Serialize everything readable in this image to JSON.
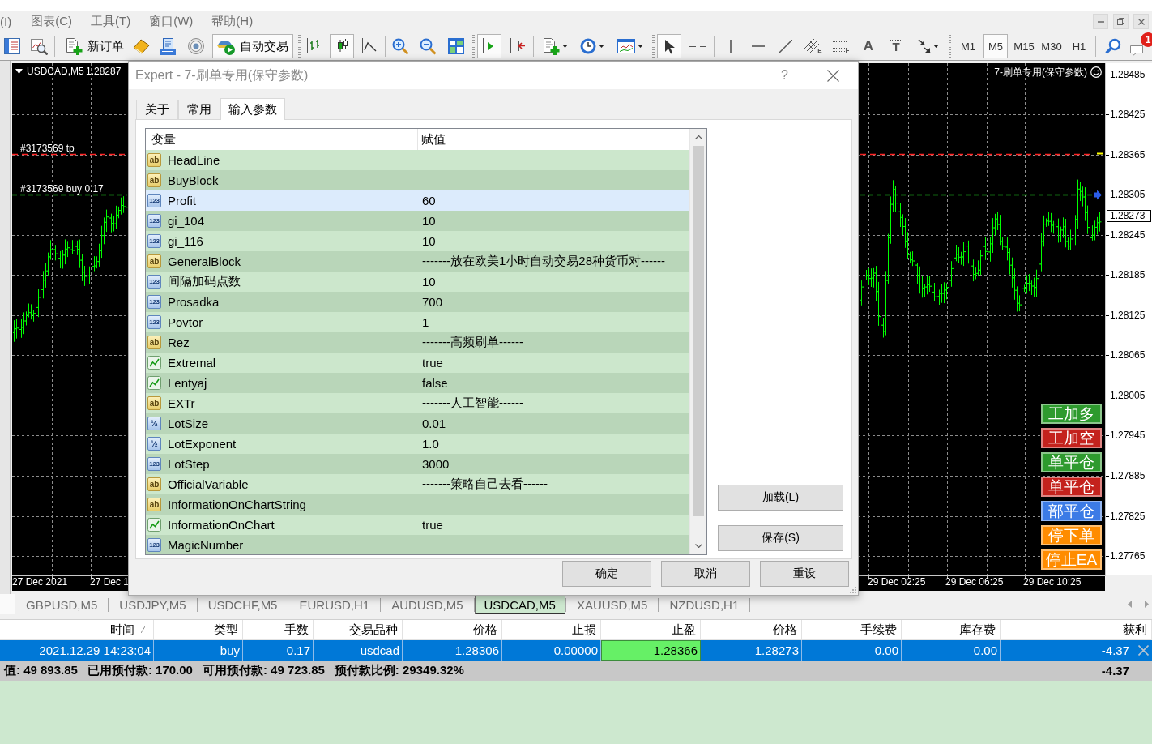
{
  "menu": [
    "(I)",
    "图表(C)",
    "工具(T)",
    "窗口(W)",
    "帮助(H)"
  ],
  "toolbar": {
    "new_order": "新订单",
    "auto_trading": {
      "label": "自动交易",
      "on": true
    },
    "chart_types": [
      {
        "selected": false
      },
      {
        "selected": true
      },
      {
        "selected": false
      }
    ],
    "chart_shift": {
      "on": true
    },
    "auto_scroll": {
      "on": false
    },
    "cursor_tools": [
      {
        "selected": true
      },
      {
        "selected": false
      }
    ],
    "channel_mark": "E",
    "fibo_mark": "F",
    "text_tool": "A",
    "label_tool": "T",
    "timeframes": [
      {
        "label": "M1",
        "selected": false
      },
      {
        "label": "M5",
        "selected": true
      },
      {
        "label": "M15",
        "selected": false
      },
      {
        "label": "M30",
        "selected": false
      },
      {
        "label": "H1",
        "selected": false
      }
    ],
    "notifications": "1"
  },
  "chart": {
    "symbol": "USDCAD,M5",
    "last_price": "1.28287",
    "expert_name": "7-刷单专用(保守参数)",
    "order_labels": [
      {
        "kind": "take_profit",
        "text": "#3173569 tp"
      },
      {
        "kind": "open",
        "text": "#3173569 buy 0.17"
      }
    ],
    "price_scale": [
      "1.28485",
      "1.28425",
      "1.28365",
      "1.28305",
      "1.28245",
      "1.28185",
      "1.28125",
      "1.28065",
      "1.28005",
      "1.27945",
      "1.27885",
      "1.27825",
      "1.27765"
    ],
    "bid": "1.28273",
    "time_scale": [
      "27 Dec 2021",
      "27 Dec 1",
      "29 Dec 02:25",
      "29 Dec 06:25",
      "29 Dec 10:25"
    ],
    "panel_buttons": [
      {
        "label": "工加多",
        "color": "#2e9a2e"
      },
      {
        "label": "工加空",
        "color": "#c4221d"
      },
      {
        "label": "单平仓",
        "color": "#2e9a2e"
      },
      {
        "label": "单平仓",
        "color": "#c4221d"
      },
      {
        "label": "部平仓",
        "color": "#3c7be6"
      },
      {
        "label": "停下单",
        "color": "#ff8c00"
      },
      {
        "label": "停止EA",
        "color": "#ff8c00"
      }
    ]
  },
  "dialog": {
    "title": "Expert - 7-刷单专用(保守参数)",
    "help": "?",
    "tabs": [
      {
        "label": "关于",
        "selected": false
      },
      {
        "label": "常用",
        "selected": false
      },
      {
        "label": "输入参数",
        "selected": true
      }
    ],
    "table": {
      "columns": [
        "变量",
        "赋值"
      ],
      "rows": [
        {
          "kind": "string",
          "badge": "ab",
          "name": "HeadLine",
          "selected": false
        },
        {
          "kind": "string",
          "badge": "ab",
          "name": "BuyBlock",
          "selected": false
        },
        {
          "kind": "int",
          "badge": "123",
          "name": "Profit",
          "value": "60",
          "selected": true
        },
        {
          "kind": "int",
          "badge": "123",
          "name": "gi_104",
          "value": "10",
          "selected": false
        },
        {
          "kind": "int",
          "badge": "123",
          "name": "gi_116",
          "value": "10",
          "selected": false
        },
        {
          "kind": "string",
          "badge": "ab",
          "name": "GeneralBlock",
          "value": "-------放在欧美1小时自动交易28种货币对------",
          "selected": false
        },
        {
          "kind": "int",
          "badge": "123",
          "name": "间隔加码点数",
          "value": "10",
          "selected": false
        },
        {
          "kind": "int",
          "badge": "123",
          "name": "Prosadka",
          "value": "700",
          "selected": false
        },
        {
          "kind": "int",
          "badge": "123",
          "name": "Povtor",
          "value": "1",
          "selected": false
        },
        {
          "kind": "string",
          "badge": "ab",
          "name": "Rez",
          "value": "-------高频刷单------",
          "selected": false
        },
        {
          "kind": "bool",
          "name": "Extremal",
          "value": "true",
          "selected": false
        },
        {
          "kind": "bool",
          "name": "Lentyaj",
          "value": "false",
          "selected": false
        },
        {
          "kind": "string",
          "badge": "ab",
          "name": "EXTr",
          "value": "-------人工智能------",
          "selected": false
        },
        {
          "kind": "double",
          "badge": "½",
          "name": "LotSize",
          "value": "0.01",
          "selected": false
        },
        {
          "kind": "double",
          "badge": "½",
          "name": "LotExponent",
          "value": "1.0",
          "selected": false
        },
        {
          "kind": "int",
          "badge": "123",
          "name": "LotStep",
          "value": "3000",
          "selected": false
        },
        {
          "kind": "string",
          "badge": "ab",
          "name": "OfficialVariable",
          "value": "-------策略自己去看------",
          "selected": false
        },
        {
          "kind": "string",
          "badge": "ab",
          "name": "InformationOnChartString",
          "selected": false
        },
        {
          "kind": "bool",
          "name": "InformationOnChart",
          "value": "true",
          "selected": false
        },
        {
          "kind": "int",
          "badge": "123",
          "name": "MagicNumber",
          "selected": false
        }
      ]
    },
    "side_buttons": [
      "加载(L)",
      "保存(S)"
    ],
    "buttons": [
      "确定",
      "取消",
      "重设"
    ]
  },
  "chart_tabs": [
    {
      "label": "GBPUSD,M5",
      "selected": false
    },
    {
      "label": "USDJPY,M5",
      "selected": false
    },
    {
      "label": "USDCHF,M5",
      "selected": false
    },
    {
      "label": "EURUSD,H1",
      "selected": false
    },
    {
      "label": "AUDUSD,M5",
      "selected": false
    },
    {
      "label": "USDCAD,M5",
      "selected": true
    },
    {
      "label": "XAUUSD,M5",
      "selected": false
    },
    {
      "label": "NZDUSD,H1",
      "selected": false
    }
  ],
  "terminal": {
    "columns": [
      {
        "label": "时间",
        "sorted": true
      },
      {
        "label": "类型",
        "sorted": false
      },
      {
        "label": "手数",
        "sorted": false
      },
      {
        "label": "交易品种",
        "sorted": false
      },
      {
        "label": "价格",
        "sorted": false
      },
      {
        "label": "止损",
        "sorted": false
      },
      {
        "label": "止盈",
        "sorted": false
      },
      {
        "label": "价格",
        "sorted": false
      },
      {
        "label": "手续费",
        "sorted": false
      },
      {
        "label": "库存费",
        "sorted": false
      },
      {
        "label": "获利",
        "sorted": false
      }
    ],
    "rows": [
      {
        "selected": true,
        "cells": [
          {
            "text": "2021.12.29 14:23:04",
            "highlighted": false
          },
          {
            "text": "buy",
            "highlighted": false
          },
          {
            "text": "0.17",
            "highlighted": false
          },
          {
            "text": "usdcad",
            "highlighted": false
          },
          {
            "text": "1.28306",
            "highlighted": false
          },
          {
            "text": "0.00000",
            "highlighted": false
          },
          {
            "text": "1.28366",
            "highlighted": true
          },
          {
            "text": "1.28273",
            "highlighted": false
          },
          {
            "text": "0.00",
            "highlighted": false
          },
          {
            "text": "0.00",
            "highlighted": false
          },
          {
            "text": "-4.37",
            "highlighted": false
          }
        ]
      }
    ],
    "summary": [
      "值: 49 893.85",
      "已用预付款: 170.00",
      "可用预付款: 49 723.85",
      "预付款比例: 29349.32%"
    ],
    "total": "-4.37"
  }
}
